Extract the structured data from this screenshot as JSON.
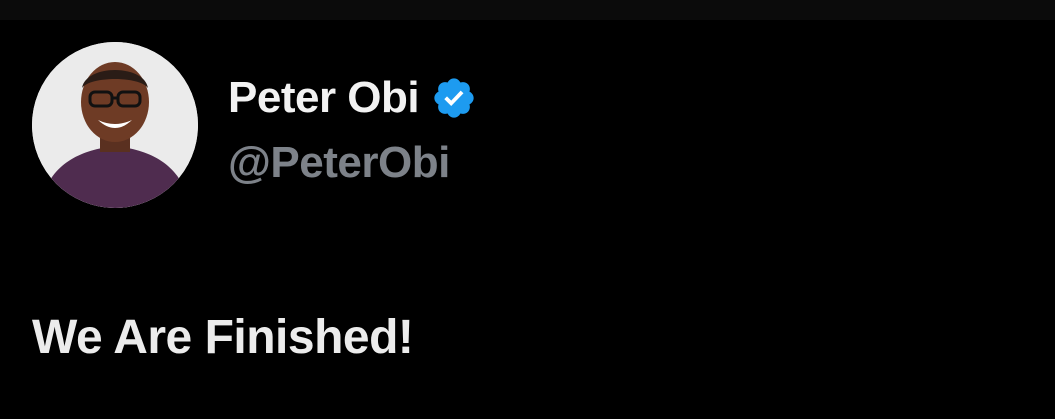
{
  "tweet": {
    "author": {
      "display_name": "Peter Obi",
      "handle": "@PeterObi",
      "verified": true,
      "avatar_icon": "profile-photo",
      "verified_icon": "verified-badge-icon"
    },
    "text": "We Are Finished!"
  },
  "colors": {
    "background": "#000000",
    "name": "#f2f2f2",
    "handle": "#7d8289",
    "verified": "#1d9bf0"
  }
}
